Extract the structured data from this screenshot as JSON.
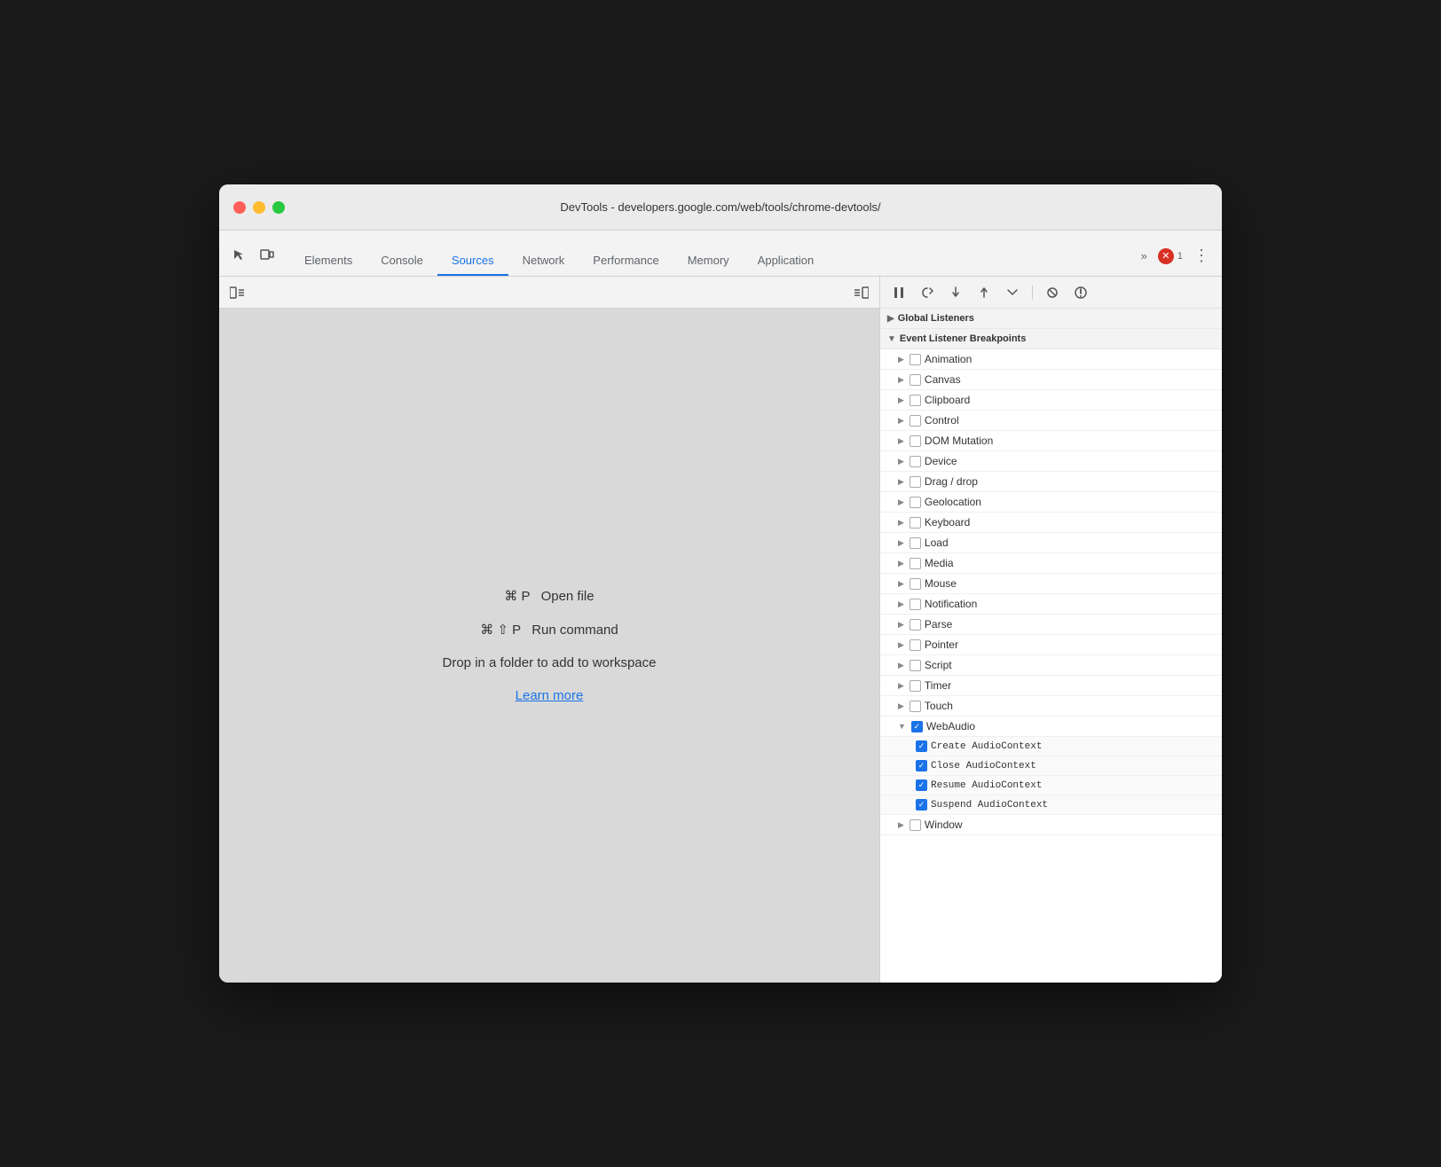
{
  "window": {
    "title": "DevTools - developers.google.com/web/tools/chrome-devtools/"
  },
  "tabs": [
    {
      "id": "elements",
      "label": "Elements",
      "active": false
    },
    {
      "id": "console",
      "label": "Console",
      "active": false
    },
    {
      "id": "sources",
      "label": "Sources",
      "active": true
    },
    {
      "id": "network",
      "label": "Network",
      "active": false
    },
    {
      "id": "performance",
      "label": "Performance",
      "active": false
    },
    {
      "id": "memory",
      "label": "Memory",
      "active": false
    },
    {
      "id": "application",
      "label": "Application",
      "active": false
    }
  ],
  "error_count": "1",
  "sources": {
    "shortcut1_keys": "⌘ P",
    "shortcut1_label": "Open file",
    "shortcut2_keys": "⌘ ⇧ P",
    "shortcut2_label": "Run command",
    "drop_text": "Drop in a folder to add to workspace",
    "learn_more": "Learn more"
  },
  "event_listener_breakpoints": {
    "section_label": "Event Listener Breakpoints",
    "global_listeners_label": "Global Listeners",
    "items": [
      {
        "id": "animation",
        "label": "Animation",
        "checked": false
      },
      {
        "id": "canvas",
        "label": "Canvas",
        "checked": false
      },
      {
        "id": "clipboard",
        "label": "Clipboard",
        "checked": false
      },
      {
        "id": "control",
        "label": "Control",
        "checked": false
      },
      {
        "id": "dom-mutation",
        "label": "DOM Mutation",
        "checked": false
      },
      {
        "id": "device",
        "label": "Device",
        "checked": false
      },
      {
        "id": "drag-drop",
        "label": "Drag / drop",
        "checked": false
      },
      {
        "id": "geolocation",
        "label": "Geolocation",
        "checked": false
      },
      {
        "id": "keyboard",
        "label": "Keyboard",
        "checked": false
      },
      {
        "id": "load",
        "label": "Load",
        "checked": false
      },
      {
        "id": "media",
        "label": "Media",
        "checked": false
      },
      {
        "id": "mouse",
        "label": "Mouse",
        "checked": false
      },
      {
        "id": "notification",
        "label": "Notification",
        "checked": false
      },
      {
        "id": "parse",
        "label": "Parse",
        "checked": false
      },
      {
        "id": "pointer",
        "label": "Pointer",
        "checked": false
      },
      {
        "id": "script",
        "label": "Script",
        "checked": false
      },
      {
        "id": "timer",
        "label": "Timer",
        "checked": false
      },
      {
        "id": "touch",
        "label": "Touch",
        "checked": false
      },
      {
        "id": "webaudio",
        "label": "WebAudio",
        "checked": true,
        "expanded": true
      },
      {
        "id": "window",
        "label": "Window",
        "checked": false
      }
    ],
    "webaudio_sub_items": [
      {
        "id": "create-audio-context",
        "label": "Create AudioContext",
        "checked": true
      },
      {
        "id": "close-audio-context",
        "label": "Close AudioContext",
        "checked": true
      },
      {
        "id": "resume-audio-context",
        "label": "Resume AudioContext",
        "checked": true
      },
      {
        "id": "suspend-audio-context",
        "label": "Suspend AudioContext",
        "checked": true
      }
    ]
  }
}
